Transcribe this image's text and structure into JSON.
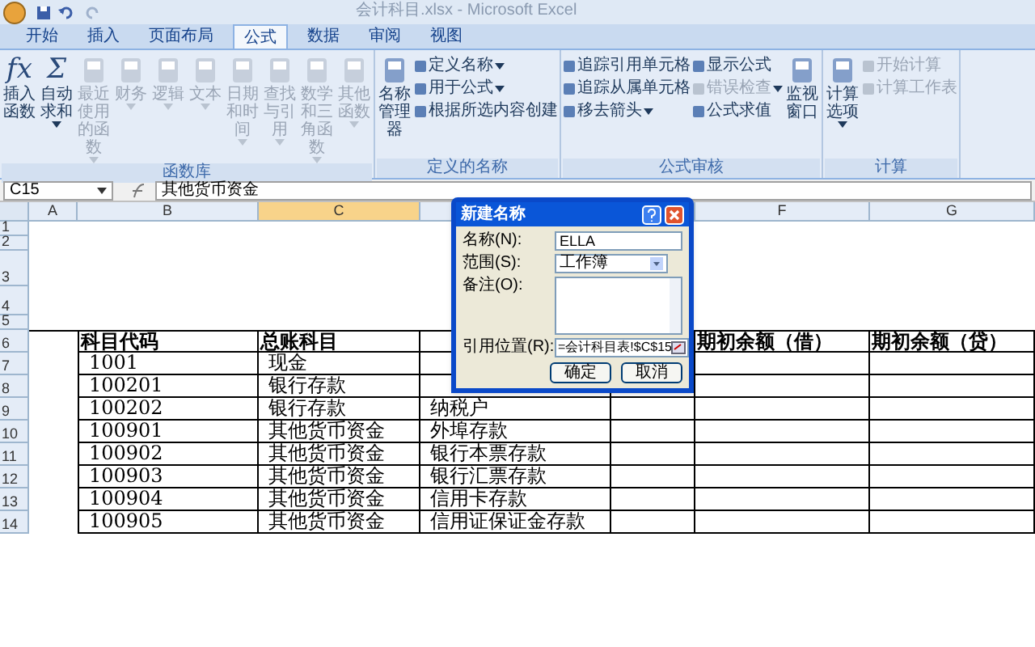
{
  "window": {
    "title": "会计科目.xlsx - Microsoft Excel"
  },
  "tabs": [
    {
      "label": "开始",
      "selected": false
    },
    {
      "label": "插入",
      "selected": false
    },
    {
      "label": "页面布局",
      "selected": false
    },
    {
      "label": "公式",
      "selected": true
    },
    {
      "label": "数据",
      "selected": false
    },
    {
      "label": "审阅",
      "selected": false
    },
    {
      "label": "视图",
      "selected": false
    }
  ],
  "ribbon": {
    "groups": [
      {
        "label": "函数库",
        "items": [
          {
            "kind": "large",
            "label": "插入函数",
            "glyph": "fx",
            "disabled": false
          },
          {
            "kind": "large",
            "label": "自动求和",
            "glyph": "Σ",
            "disabled": false,
            "menu": true
          },
          {
            "kind": "large",
            "label": "最近使用的函数",
            "disabled": true,
            "menu": true
          },
          {
            "kind": "large",
            "label": "财务",
            "disabled": true,
            "menu": true
          },
          {
            "kind": "large",
            "label": "逻辑",
            "disabled": true,
            "menu": true
          },
          {
            "kind": "large",
            "label": "文本",
            "disabled": true,
            "menu": true
          },
          {
            "kind": "large",
            "label": "日期和时间",
            "disabled": true,
            "menu": true
          },
          {
            "kind": "large",
            "label": "查找与引用",
            "disabled": true,
            "menu": true
          },
          {
            "kind": "large",
            "label": "数学和三角函数",
            "disabled": true,
            "menu": true
          },
          {
            "kind": "large",
            "label": "其他函数",
            "disabled": true,
            "menu": true
          }
        ]
      },
      {
        "label": "定义的名称",
        "items": [
          {
            "kind": "large",
            "label": "名称管理器",
            "disabled": false
          },
          {
            "kind": "small",
            "label": "定义名称",
            "disabled": false,
            "menu": true
          },
          {
            "kind": "small",
            "label": "用于公式",
            "disabled": false,
            "menu": true
          },
          {
            "kind": "small",
            "label": "根据所选内容创建",
            "disabled": false
          }
        ]
      },
      {
        "label": "公式审核",
        "items": [
          {
            "kind": "small",
            "label": "追踪引用单元格",
            "disabled": false
          },
          {
            "kind": "small",
            "label": "追踪从属单元格",
            "disabled": false
          },
          {
            "kind": "small",
            "label": "移去箭头",
            "disabled": false,
            "menu": true
          },
          {
            "kind": "small",
            "label": "显示公式",
            "disabled": false
          },
          {
            "kind": "small",
            "label": "错误检查",
            "disabled": true,
            "menu": true
          },
          {
            "kind": "small",
            "label": "公式求值",
            "disabled": false
          },
          {
            "kind": "large",
            "label": "监视窗口",
            "disabled": false
          }
        ]
      },
      {
        "label": "计算",
        "items": [
          {
            "kind": "large",
            "label": "计算选项",
            "disabled": false,
            "menu": true
          },
          {
            "kind": "small",
            "label": "开始计算",
            "disabled": true
          },
          {
            "kind": "small",
            "label": "计算工作表",
            "disabled": true
          }
        ]
      }
    ]
  },
  "formula_bar": {
    "name_box": "C15",
    "content": "其他货币资金"
  },
  "sheet": {
    "columns": {
      "column_a": {
        "label": "A",
        "selected": false
      },
      "column_b": {
        "label": "B",
        "selected": false
      },
      "column_c": {
        "label": "C",
        "selected": true
      },
      "column_f": {
        "label": "F",
        "selected": false
      },
      "column_g": {
        "label": "G",
        "selected": false
      }
    },
    "rows": [
      {
        "number": "1"
      },
      {
        "number": "2"
      },
      {
        "number": "3"
      },
      {
        "number": "4"
      },
      {
        "number": "5"
      },
      {
        "number": "6",
        "cells": {
          "column_b": "科目代码",
          "column_c": "总账科目",
          "column_f": "期初余额（借）",
          "column_g": "期初余额（贷）"
        }
      },
      {
        "number": "7",
        "cells": {
          "column_b": "1001",
          "column_c": "现金"
        }
      },
      {
        "number": "8",
        "cells": {
          "column_b": "100201",
          "column_c": "银行存款"
        }
      },
      {
        "number": "9",
        "cells": {
          "column_b": "100202",
          "column_c": "银行存款",
          "column_d": "纳税户"
        }
      },
      {
        "number": "10",
        "cells": {
          "column_b": "100901",
          "column_c": "其他货币资金",
          "column_d": "外埠存款"
        }
      },
      {
        "number": "11",
        "cells": {
          "column_b": "100902",
          "column_c": "其他货币资金",
          "column_d": "银行本票存款"
        }
      },
      {
        "number": "12",
        "cells": {
          "column_b": "100903",
          "column_c": "其他货币资金",
          "column_d": "银行汇票存款"
        }
      },
      {
        "number": "13",
        "cells": {
          "column_b": "100904",
          "column_c": "其他货币资金",
          "column_d": "信用卡存款"
        }
      },
      {
        "number": "14",
        "cells": {
          "column_b": "100905",
          "column_c": "其他货币资金",
          "column_d": "信用证保证金存款"
        }
      }
    ]
  },
  "dialog": {
    "title": "新建名称",
    "fields": [
      {
        "kind": "text",
        "label": "名称(N):",
        "value": "ELLA"
      },
      {
        "kind": "select",
        "label": "范围(S):",
        "value": "工作簿"
      },
      {
        "kind": "textarea",
        "label": "备注(O):"
      },
      {
        "kind": "ref",
        "label": "引用位置(R):",
        "value": "=会计科目表!$C$15"
      }
    ],
    "buttons": [
      "确定",
      "取消"
    ]
  }
}
